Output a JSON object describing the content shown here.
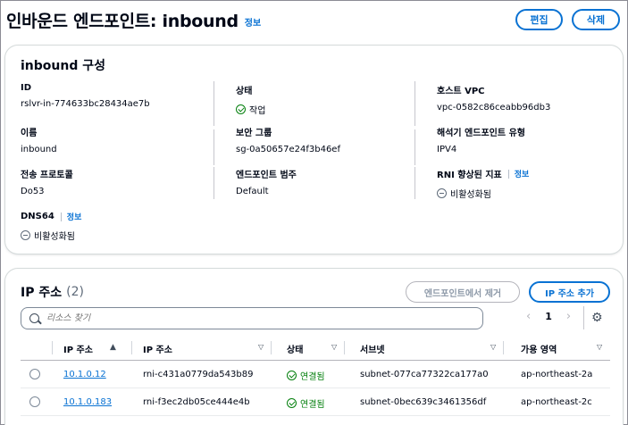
{
  "page": {
    "title": "인바운드 엔드포인트: inbound",
    "info": "정보",
    "edit_label": "편집",
    "delete_label": "삭제"
  },
  "config": {
    "title": "inbound 구성",
    "id_label": "ID",
    "id_value": "rslvr-in-774633bc28434ae7b",
    "status_label": "상태",
    "status_value": "작업",
    "vpc_label": "호스트 VPC",
    "vpc_value": "vpc-0582c86ceabb96db3",
    "name_label": "이름",
    "name_value": "inbound",
    "sg_label": "보안 그룹",
    "sg_value": "sg-0a50657e24f3b46ef",
    "resolver_type_label": "해석기 엔드포인트 유형",
    "resolver_type_value": "IPV4",
    "protocol_label": "전송 프로토콜",
    "protocol_value": "Do53",
    "category_label": "엔드포인트 범주",
    "category_value": "Default",
    "rni_label": "RNI 향상된 지표",
    "rni_info": "정보",
    "rni_value": "비활성화됨",
    "dns64_label": "DNS64",
    "dns64_info": "정보",
    "dns64_value": "비활성화됨"
  },
  "ip": {
    "title": "IP 주소",
    "count": "(2)",
    "remove_label": "엔드포인트에서 제거",
    "add_label": "IP 주소 추가",
    "search_placeholder": "리소스 찾기",
    "page_number": "1",
    "columns": [
      "IP 주소",
      "IP 주소",
      "상태",
      "서브넷",
      "가용 영역"
    ],
    "rows": [
      {
        "ip": "10.1.0.12",
        "rni": "rni-c431a0779da543b89",
        "status": "연결됨",
        "subnet": "subnet-077ca77322ca177a0",
        "az": "ap-northeast-2a"
      },
      {
        "ip": "10.1.0.183",
        "rni": "rni-f3ec2db05ce444e4b",
        "status": "연결됨",
        "subnet": "subnet-0bec639c3461356df",
        "az": "ap-northeast-2c"
      }
    ]
  }
}
